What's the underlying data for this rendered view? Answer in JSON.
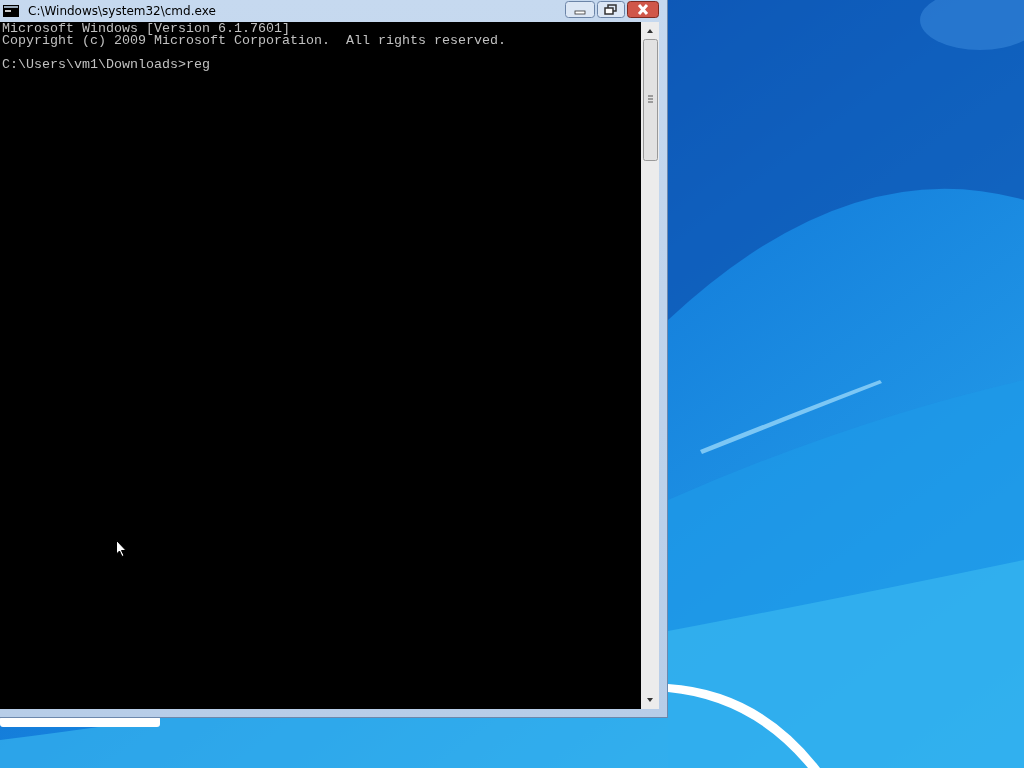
{
  "window": {
    "title": "C:\\Windows\\system32\\cmd.exe"
  },
  "console": {
    "banner": [
      "Microsoft Windows [Version 6.1.7601]",
      "Copyright (c) 2009 Microsoft Corporation.  All rights reserved."
    ],
    "prompt": "C:\\Users\\vm1\\Downloads>reg"
  }
}
